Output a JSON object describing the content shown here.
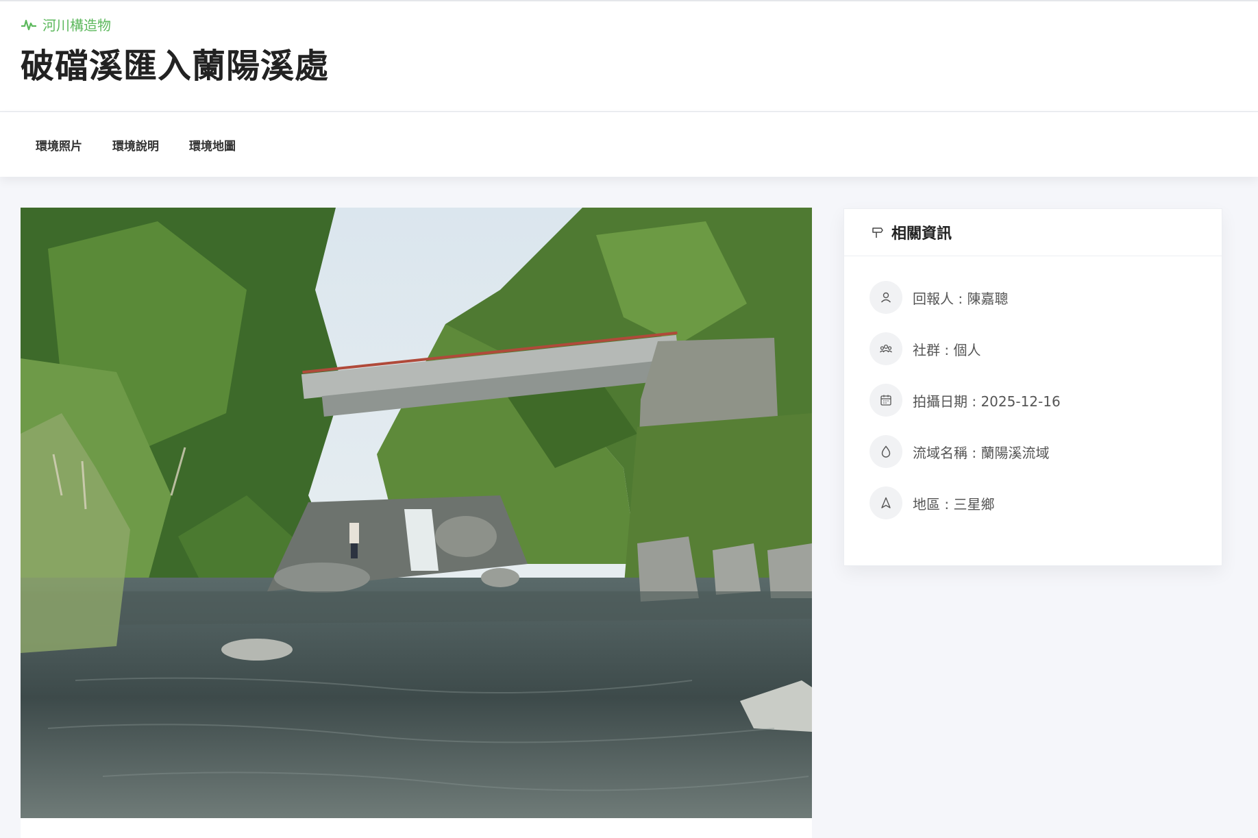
{
  "header": {
    "category_label": "河川構造物",
    "category_icon": "pulse-icon",
    "accent_color": "#5cb85c",
    "title": "破礑溪匯入蘭陽溪處"
  },
  "tabs": [
    {
      "label": "環境照片"
    },
    {
      "label": "環境說明"
    },
    {
      "label": "環境地圖"
    }
  ],
  "photo": {
    "subject": "river-with-bridge-photo"
  },
  "info": {
    "title": "相關資訊",
    "title_icon": "signpost-icon",
    "items": [
      {
        "icon": "user-icon",
        "text": "回報人 : 陳嘉聰"
      },
      {
        "icon": "group-icon",
        "text": "社群 : 個人"
      },
      {
        "icon": "calendar-icon",
        "text": "拍攝日期 : 2025-12-16"
      },
      {
        "icon": "water-drop-icon",
        "text": "流域名稱 : 蘭陽溪流域"
      },
      {
        "icon": "navigation-icon",
        "text": "地區 : 三星鄉"
      }
    ]
  }
}
